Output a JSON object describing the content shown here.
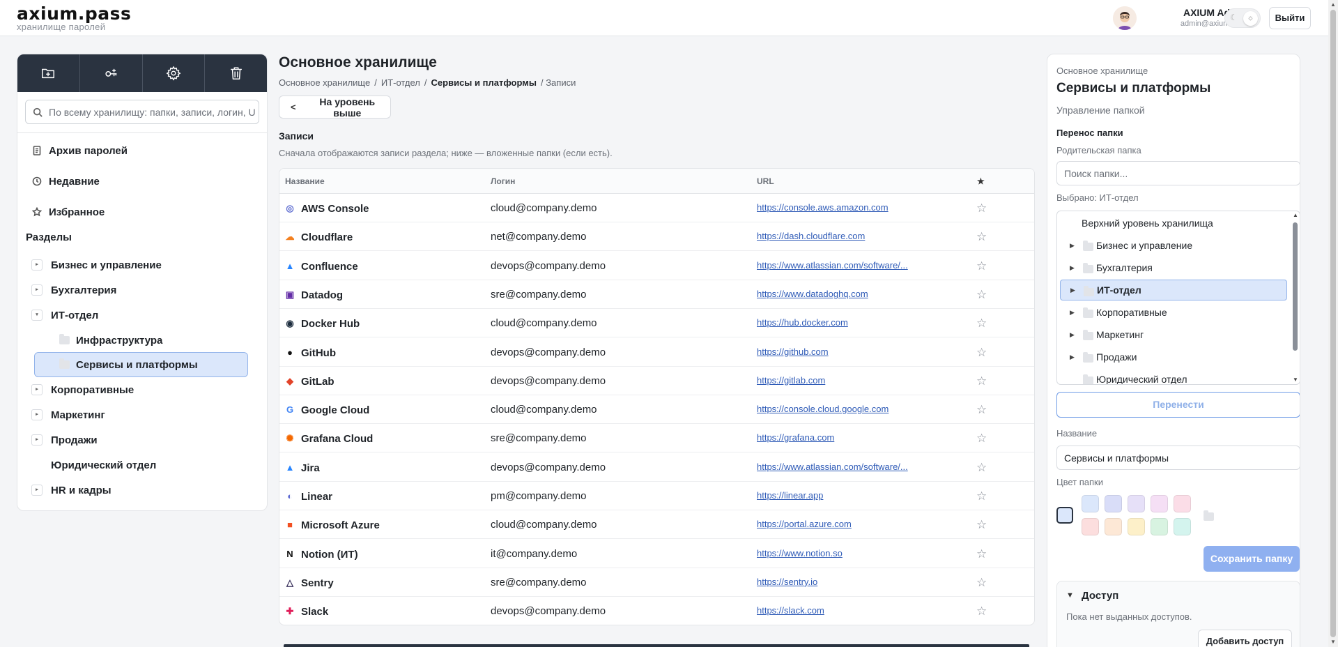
{
  "app": {
    "logo": "axium.pass",
    "logo_sub": "хранилище паролей",
    "user_name": "AXIUM Admin",
    "user_email": "admin@axium.local",
    "logout_label": "Выйти"
  },
  "sidebar": {
    "toolbar": [
      "new-folder-icon",
      "key-icon",
      "gear-icon",
      "trash-icon"
    ],
    "search_placeholder": "По всему хранилищу: папки, записи, логин, URL",
    "nav": [
      {
        "label": "Архив паролей",
        "icon": "document-icon"
      },
      {
        "label": "Недавние",
        "icon": "clock-icon"
      },
      {
        "label": "Избранное",
        "icon": "star-icon"
      }
    ],
    "sections_label": "Разделы",
    "tree": [
      {
        "label": "Бизнес и управление",
        "expanded": false
      },
      {
        "label": "Бухгалтерия",
        "expanded": false
      },
      {
        "label": "ИТ-отдел",
        "expanded": true
      },
      {
        "label": "Инфраструктура",
        "child": true
      },
      {
        "label": "Сервисы и платформы",
        "child": true,
        "selected": true
      },
      {
        "label": "Корпоративные",
        "expanded": false
      },
      {
        "label": "Маркетинг",
        "expanded": false
      },
      {
        "label": "Продажи",
        "expanded": false
      },
      {
        "label": "Юридический отдел",
        "leaf": true
      },
      {
        "label": "HR и кадры",
        "expanded": false
      }
    ]
  },
  "main": {
    "title": "Основное хранилище",
    "breadcrumb": [
      "Основное хранилище",
      "/",
      "ИТ-отдел",
      "/",
      "Сервисы и платформы",
      "/ Записи"
    ],
    "up_label": "На уровень выше",
    "records_title": "Записи",
    "records_sub": "Сначала отображаются записи раздела; ниже — вложенные папки (если есть).",
    "columns": [
      "Название",
      "Логин",
      "URL",
      "★"
    ],
    "rows": [
      {
        "name": "AWS Console",
        "login": "cloud@company.demo",
        "url": "https://console.aws.amazon.com",
        "icon": "aws-icon",
        "color": "#5b6ad0"
      },
      {
        "name": "Cloudflare",
        "login": "net@company.demo",
        "url": "https://dash.cloudflare.com",
        "icon": "cloudflare-icon",
        "color": "#f38020"
      },
      {
        "name": "Confluence",
        "login": "devops@company.demo",
        "url": "https://www.atlassian.com/software/...",
        "icon": "confluence-icon",
        "color": "#2684ff"
      },
      {
        "name": "Datadog",
        "login": "sre@company.demo",
        "url": "https://www.datadoghq.com",
        "icon": "datadog-icon",
        "color": "#632ca6"
      },
      {
        "name": "Docker Hub",
        "login": "cloud@company.demo",
        "url": "https://hub.docker.com",
        "icon": "docker-icon",
        "color": "#1d2d3e"
      },
      {
        "name": "GitHub",
        "login": "devops@company.demo",
        "url": "https://github.com",
        "icon": "github-icon",
        "color": "#111111"
      },
      {
        "name": "GitLab",
        "login": "devops@company.demo",
        "url": "https://gitlab.com",
        "icon": "gitlab-icon",
        "color": "#e24329"
      },
      {
        "name": "Google Cloud",
        "login": "cloud@company.demo",
        "url": "https://console.cloud.google.com",
        "icon": "google-icon",
        "color": "#4285f4"
      },
      {
        "name": "Grafana Cloud",
        "login": "sre@company.demo",
        "url": "https://grafana.com",
        "icon": "grafana-icon",
        "color": "#f46800"
      },
      {
        "name": "Jira",
        "login": "devops@company.demo",
        "url": "https://www.atlassian.com/software/...",
        "icon": "jira-icon",
        "color": "#2684ff"
      },
      {
        "name": "Linear",
        "login": "pm@company.demo",
        "url": "https://linear.app",
        "icon": "linear-icon",
        "color": "#5e6ad2"
      },
      {
        "name": "Microsoft Azure",
        "login": "cloud@company.demo",
        "url": "https://portal.azure.com",
        "icon": "microsoft-icon",
        "color": "#f25022"
      },
      {
        "name": "Notion (ИТ)",
        "login": "it@company.demo",
        "url": "https://www.notion.so",
        "icon": "notion-icon",
        "color": "#111111"
      },
      {
        "name": "Sentry",
        "login": "sre@company.demo",
        "url": "https://sentry.io",
        "icon": "sentry-icon",
        "color": "#362d59"
      },
      {
        "name": "Slack",
        "login": "devops@company.demo",
        "url": "https://slack.com",
        "icon": "slack-icon",
        "color": "#e01e5a"
      }
    ]
  },
  "panel": {
    "crumb": "Основное хранилище",
    "title": "Сервисы и платформы",
    "subtitle": "Управление папкой",
    "move_title": "Перенос папки",
    "parent_label": "Родительская папка",
    "parent_placeholder": "Поиск папки...",
    "selected_text": "Выбрано: ИТ-отдел",
    "tree_top": "Верхний уровень хранилища",
    "tree": [
      "Бизнес и управление",
      "Бухгалтерия",
      "ИТ-отдел",
      "Корпоративные",
      "Маркетинг",
      "Продажи",
      "Юридический отдел"
    ],
    "move_btn": "Перенести",
    "name_label": "Название",
    "name_value": "Сервисы и платформы",
    "color_label": "Цвет папки",
    "colors": [
      "#dbe7fb",
      "#d9ddf8",
      "#e6e0f8",
      "#f5dff5",
      "#fbdde7",
      "#fcdede",
      "#fde8d6",
      "#fdf0c9",
      "#d8f3e1",
      "#d4f4ee"
    ],
    "save_btn": "Сохранить папку",
    "access_title": "Доступ",
    "access_text": "Пока нет выданных доступов.",
    "access_add": "Добавить доступ"
  }
}
